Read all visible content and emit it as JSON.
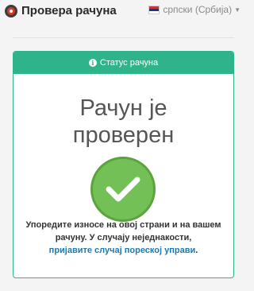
{
  "header": {
    "title": "Провера рачуна",
    "language": "српски (Србија)"
  },
  "card": {
    "heading": "Статус рачуна",
    "status_line1": "Рачун је",
    "status_line2": "проверен",
    "message_text": "Упоредите износе на овој страни и на вашем рачуну. У случају неједнакости,",
    "report_link": "пријавите случај пореској управи",
    "period": "."
  },
  "colors": {
    "accent": "#2fb38b",
    "check": "#73c056",
    "link": "#1a7ab5"
  },
  "icons": [
    "app-logo-icon",
    "serbia-flag-icon",
    "info-icon",
    "checkmark-icon"
  ]
}
